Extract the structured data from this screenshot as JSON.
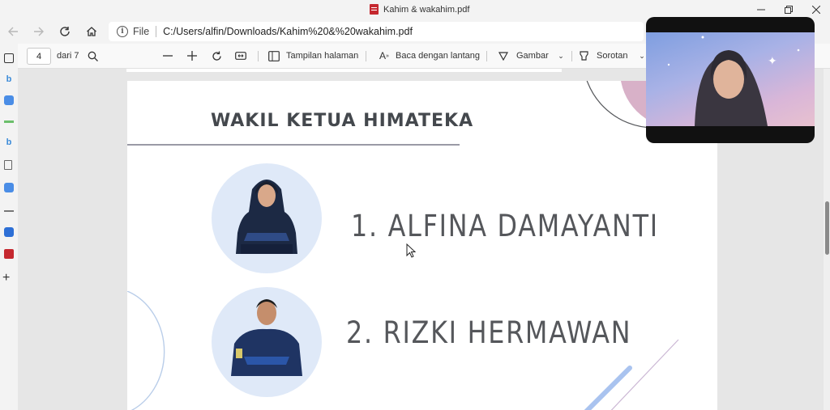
{
  "window": {
    "title": "Kahim & wakahim.pdf",
    "controls": [
      "minimize",
      "restore",
      "close"
    ]
  },
  "address_bar": {
    "scheme": "File",
    "path": "C:/Users/alfin/Downloads/Kahim%20&%20wakahim.pdf"
  },
  "sidebar": {
    "icons": [
      "tab-actions-icon",
      "bing-icon",
      "zoom-icon",
      "app-icon",
      "bing-icon",
      "page-icon",
      "zoom-icon",
      "app-icon",
      "zoom-icon",
      "pdf-icon",
      "add-icon"
    ]
  },
  "pdf_toolbar": {
    "page_number": "4",
    "page_total": "dari 7",
    "view_label": "Tampilan halaman",
    "read_aloud_label": "Baca dengan lantang",
    "draw_label": "Gambar",
    "highlight_label": "Sorotan"
  },
  "slide": {
    "title": "WAKIL KETUA  HIMATEKA",
    "members": [
      {
        "label": "1. ALFINA DAMAYANTI"
      },
      {
        "label": "2. RIZKI HERMAWAN"
      }
    ],
    "colors": {
      "title": "#44484d",
      "text": "#55575b",
      "avatar_bg": "#dfe9f8",
      "accent_circle": "#d8b1c8",
      "accent_line": "#a9c3ef"
    }
  },
  "webcam": {
    "present": true
  }
}
